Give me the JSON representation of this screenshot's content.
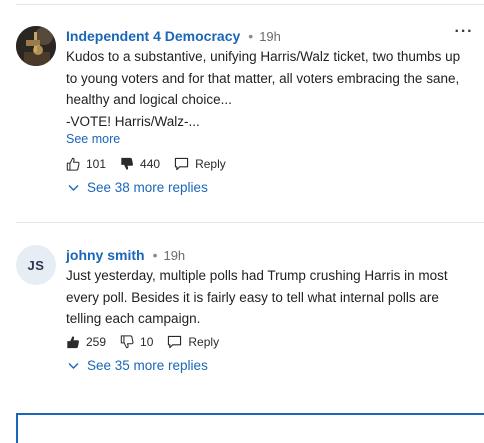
{
  "comments": [
    {
      "author": "Independent 4 Democracy",
      "separator": "•",
      "time": "19h",
      "more_menu": "···",
      "avatar_initials": "",
      "body_lines": [
        "Kudos to a substantive, unifying Harris/Walz ticket, two thumbs up",
        "to young voters and for that matter, all voters embracing the sane,",
        "healthy and logical choice...",
        "-VOTE! Harris/Walz-..."
      ],
      "see_more": "See more",
      "likes": "101",
      "dislikes": "440",
      "reply_label": "Reply",
      "replies_link": "See 38 more replies"
    },
    {
      "author": "johny smith",
      "separator": "•",
      "time": "19h",
      "more_menu": "",
      "avatar_initials": "JS",
      "body_lines": [
        "Just yesterday, multiple polls had Trump crushing Harris in most",
        "every poll. Besides it is fairly easy to tell what internal polls are",
        "telling each campaign."
      ],
      "likes": "259",
      "dislikes": "10",
      "reply_label": "Reply",
      "replies_link": "See 35 more replies"
    }
  ],
  "colors": {
    "link": "#1a66b8",
    "text": "#1f1f1f",
    "muted": "#6b6b6b",
    "divider": "#e6e6e6"
  }
}
